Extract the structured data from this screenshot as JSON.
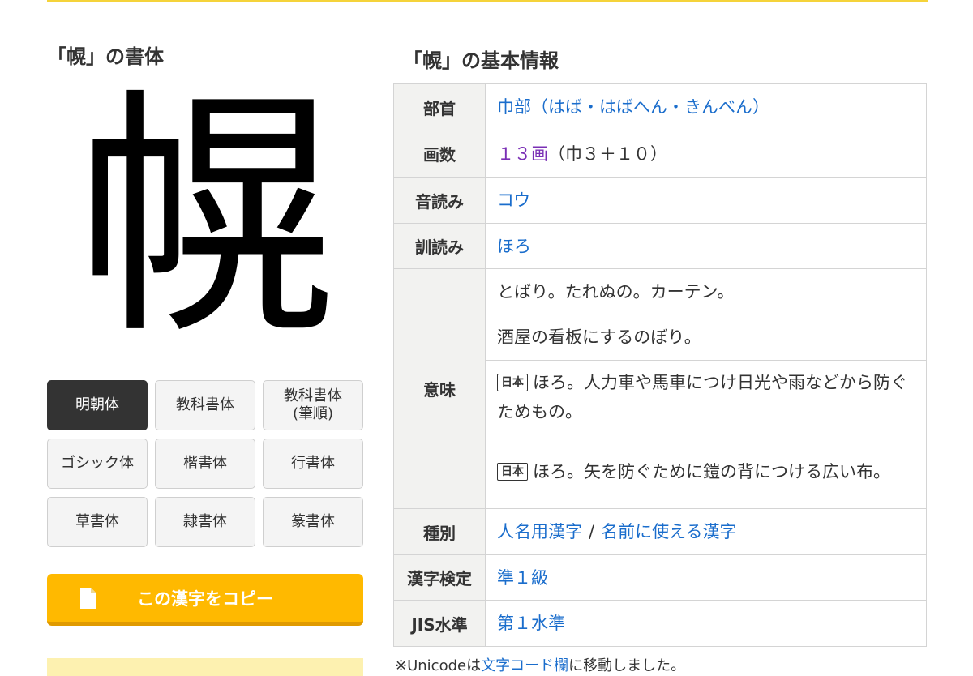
{
  "kanji": "幌",
  "left": {
    "title": "「幌」の書体",
    "fonts": [
      {
        "label": "明朝体",
        "active": true
      },
      {
        "label": "教科書体",
        "active": false
      },
      {
        "label": "教科書体\n(筆順)",
        "active": false
      },
      {
        "label": "ゴシック体",
        "active": false
      },
      {
        "label": "楷書体",
        "active": false
      },
      {
        "label": "行書体",
        "active": false
      },
      {
        "label": "草書体",
        "active": false
      },
      {
        "label": "隷書体",
        "active": false
      },
      {
        "label": "篆書体",
        "active": false
      }
    ],
    "copy_button": "この漢字をコピー",
    "copy_icon": "document-copy-icon"
  },
  "right": {
    "title": "「幌」の基本情報",
    "rows": {
      "bushu": {
        "label": "部首",
        "value": "巾部（はば・はばへん・きんべん）"
      },
      "kakusu": {
        "label": "画数",
        "value_link": "１３画",
        "value_rest": "（巾３＋１０）"
      },
      "on": {
        "label": "音読み",
        "value": "コウ"
      },
      "kun": {
        "label": "訓読み",
        "value": "ほろ"
      },
      "imi": {
        "label": "意味",
        "items": [
          {
            "tag": "",
            "text": "とばり。たれぬの。カーテン。"
          },
          {
            "tag": "",
            "text": "酒屋の看板にするのぼり。"
          },
          {
            "tag": "日本",
            "text": "ほろ。人力車や馬車につけ日光や雨などから防ぐためもの。"
          },
          {
            "tag": "日本",
            "text": "ほろ。矢を防ぐために鎧の背につける広い布。"
          }
        ]
      },
      "shubetsu": {
        "label": "種別",
        "value1": "人名用漢字",
        "sep": "/",
        "value2": "名前に使える漢字"
      },
      "kentei": {
        "label": "漢字検定",
        "value": "準１級"
      },
      "jis": {
        "label": "JIS水準",
        "value": "第１水準"
      }
    },
    "note": {
      "prefix": "※Unicodeは",
      "link": "文字コード欄",
      "suffix": "に移動しました。"
    }
  },
  "colors": {
    "accent": "#ffb900",
    "link": "#1a6dcc",
    "active_tab": "#333333",
    "top_line": "#f5d33a"
  }
}
